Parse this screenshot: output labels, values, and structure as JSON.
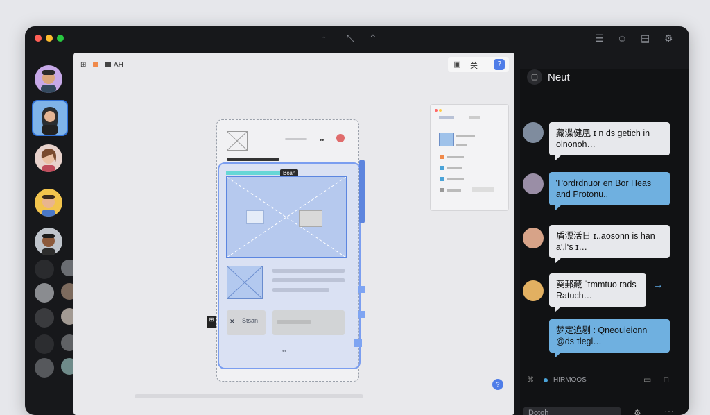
{
  "canvas_toolbar": {
    "left_a": "⊞",
    "left_b": "AH",
    "right_label": "关"
  },
  "chat": {
    "title": "Neut",
    "messages": [
      {
        "text": "藏渫健凰 ɪ n ds getich in olnonoh…",
        "style": "white"
      },
      {
        "text": "Ƭ'ordrdnuor en Bor Heas and Protonu..",
        "style": "blue"
      },
      {
        "text": "盾漂活日 ɪ..aosonn is han aʹ,l‘s ̇ɪ…",
        "style": "white"
      },
      {
        "text": "葵郵藏 ˈɪmmtuo rads Ratuch…",
        "style": "white"
      },
      {
        "text": "梦定追剔 : Qneouieionn @ds ɪlegl…",
        "style": "blue"
      }
    ],
    "footer_label": "HIRMOOS",
    "input_placeholder": "Dotoh"
  },
  "design": {
    "badge": "Bcan",
    "button_label": "Stsan"
  },
  "colors": {
    "accent": "#4f7de8",
    "chat_bg": "#111214",
    "bubble_blue": "#6fb0e0",
    "bubble_white": "#e7e8ec"
  }
}
